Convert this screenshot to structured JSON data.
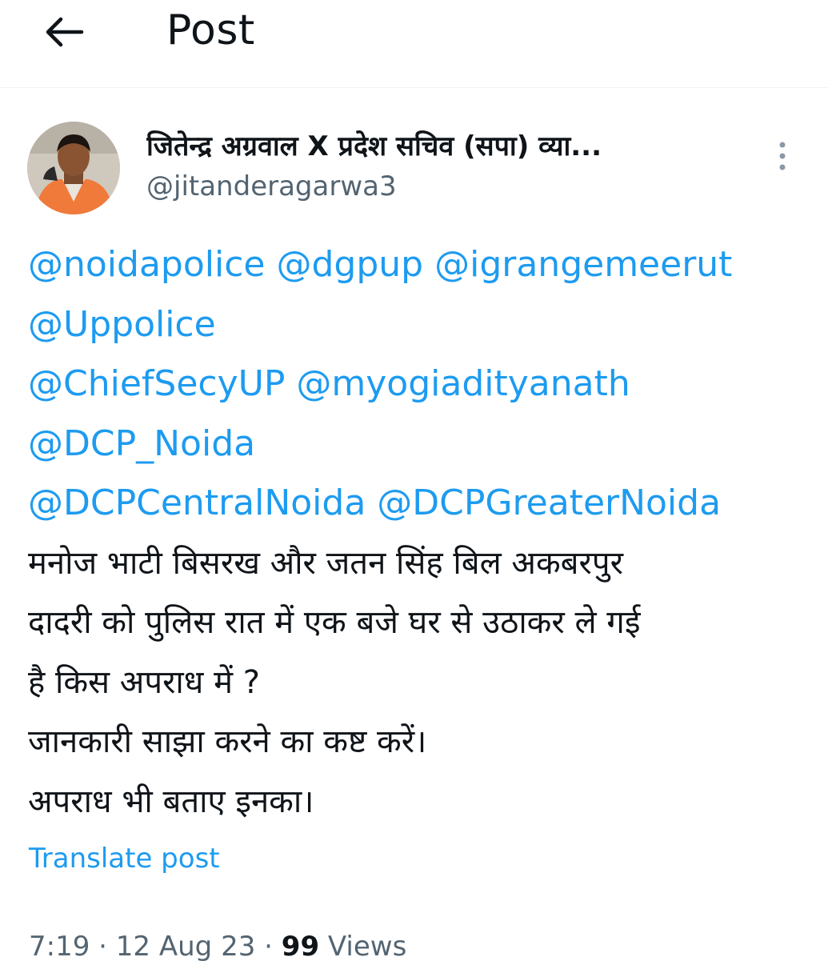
{
  "header": {
    "title": "Post",
    "back_icon": "arrow-left-icon"
  },
  "author": {
    "display_name": "जितेन्द्र अग्रवाल X प्रदेश सचिव (सपा) व्या...",
    "handle": "@jitanderagarwa3",
    "avatar_icon": "avatar",
    "more_icon": "more-vertical-icon"
  },
  "post": {
    "mentions_line1": [
      "@noidapolice",
      "@dgpup",
      "@igrangemeerut"
    ],
    "mentions_line2": [
      "@Uppolice"
    ],
    "mentions_line3": [
      "@ChiefSecyUP",
      "@myogiadityanath"
    ],
    "mentions_line4": [
      "@DCP_Noida"
    ],
    "mentions_line5": [
      "@DCPCentralNoida",
      "@DCPGreaterNoida"
    ],
    "body_lines": [
      " मनोज भाटी बिसरख और जतन सिंह बिल अकबरपुर",
      "दादरी को पुलिस रात में एक बजे घर से उठाकर ले गई",
      "है किस अपराध में ?",
      "जानकारी साझा करने का कष्ट करें।",
      "अपराध भी बताए इनका।"
    ]
  },
  "translate_label": "Translate post",
  "meta": {
    "time": "7:19",
    "separator": " · ",
    "date": "12 Aug 23",
    "views_count": "99",
    "views_label": " Views"
  },
  "colors": {
    "link": "#1d9bf0",
    "secondary_text": "#536471",
    "primary_text": "#0f1419"
  }
}
